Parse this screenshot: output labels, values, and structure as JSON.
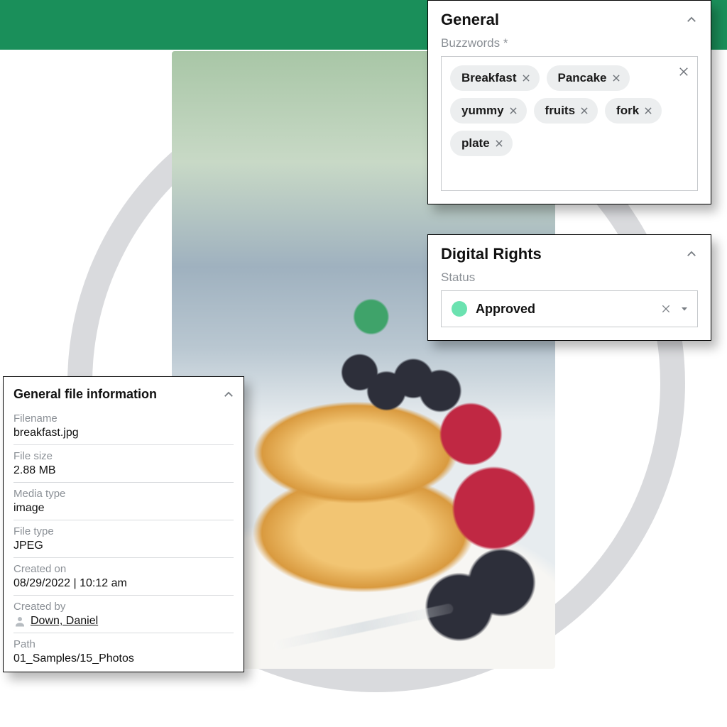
{
  "general": {
    "title": "General",
    "field_label": "Buzzwords *",
    "tags": [
      "Breakfast",
      "Pancake",
      "yummy",
      "fruits",
      "fork",
      "plate"
    ]
  },
  "rights": {
    "title": "Digital Rights",
    "field_label": "Status",
    "value": "Approved",
    "dot_color": "#6be2b0"
  },
  "fileinfo": {
    "title": "General file information",
    "items": [
      {
        "label": "Filename",
        "value": "breakfast.jpg"
      },
      {
        "label": "File size",
        "value": "2.88 MB"
      },
      {
        "label": "Media type",
        "value": "image"
      },
      {
        "label": "File type",
        "value": "JPEG"
      },
      {
        "label": "Created on",
        "value": "08/29/2022 | 10:12 am"
      },
      {
        "label": "Created by",
        "value": "Down, Daniel",
        "is_user": true
      },
      {
        "label": "Path",
        "value": "01_Samples/15_Photos"
      }
    ]
  }
}
